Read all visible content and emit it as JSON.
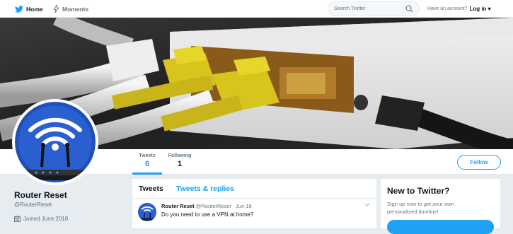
{
  "nav": {
    "home_label": "Home",
    "moments_label": "Moments",
    "search_placeholder": "Search Twitter",
    "account_prompt": "Have an account?",
    "login_label": "Log in",
    "icons": [
      "twitter-bird-icon",
      "lightning-icon",
      "search-icon",
      "caret-down-icon"
    ]
  },
  "banner": {
    "image": "ethernet cables plugged into router"
  },
  "profile": {
    "name": "Router Reset",
    "handle": "@RouterReset",
    "joined": "Joined June 2018"
  },
  "stats": {
    "tweets_label": "Tweets",
    "tweets_value": "6",
    "following_label": "Following",
    "following_value": "1"
  },
  "follow_label": "Follow",
  "timeline": {
    "tabs": [
      {
        "label": "Tweets",
        "active": true
      },
      {
        "label": "Tweets & replies",
        "active": false
      }
    ],
    "tweets": [
      {
        "name": "Router Reset",
        "meta": "@RouterReset · Jun 18",
        "text": "Do you need to use a VPN at home?"
      }
    ]
  },
  "new_to_twitter": {
    "title": "New to Twitter?",
    "text": "Sign up now to get your own personalized timeline!"
  },
  "colors": {
    "brand": "#1da1f2",
    "background": "#e6ecf0",
    "text": "#14171a",
    "muted": "#657786"
  }
}
